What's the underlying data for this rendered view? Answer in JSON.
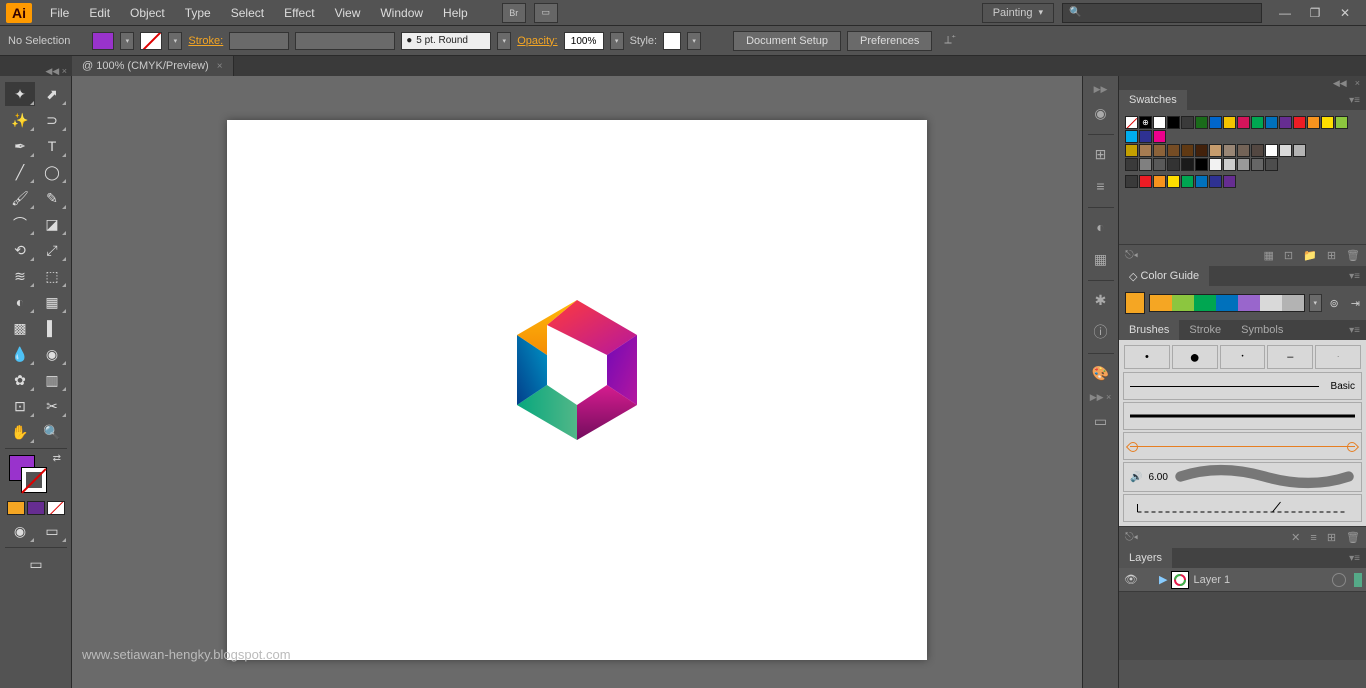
{
  "app": {
    "logo": "Ai"
  },
  "menu": [
    "File",
    "Edit",
    "Object",
    "Type",
    "Select",
    "Effect",
    "View",
    "Window",
    "Help"
  ],
  "workspace_label": "Painting",
  "controlbar": {
    "selection": "No Selection",
    "stroke_label": "Stroke:",
    "stroke_preset": "5 pt. Round",
    "opacity_label": "Opacity:",
    "opacity_value": "100%",
    "style_label": "Style:",
    "doc_setup": "Document Setup",
    "preferences": "Preferences"
  },
  "doctab": {
    "title": "@ 100% (CMYK/Preview)"
  },
  "watermark": "www.setiawan-hengky.blogspot.com",
  "panels": {
    "swatches": {
      "tab": "Swatches"
    },
    "colorguide": {
      "tab": "Color Guide"
    },
    "brushes": {
      "tabs": [
        "Brushes",
        "Stroke",
        "Symbols"
      ],
      "basic": "Basic",
      "cal": "6.00"
    },
    "layers": {
      "tab": "Layers",
      "layer1": "Layer 1"
    }
  },
  "swatch_colors_r1": [
    "#ffffff",
    "#000000",
    "#3a3a3a",
    "#1a6b1a",
    "#0066cc",
    "#f5c400",
    "#d4145a",
    "#00a651",
    "#0071bc",
    "#662d91",
    "#ed1c24",
    "#f7931e",
    "#ffde00",
    "#8cc63f",
    "#00aeef",
    "#2e3192",
    "#ec008c"
  ],
  "swatch_colors_r2": [
    "#c4a000",
    "#a67c52",
    "#8c6239",
    "#754c24",
    "#603913",
    "#42210b",
    "#c69c6d",
    "#998675",
    "#736357",
    "#534741",
    "#ffffff",
    "#d9d9d9",
    "#b3b3b3"
  ],
  "swatch_colors_r3": [
    "#808080",
    "#595959",
    "#333333",
    "#1a1a1a",
    "#000000",
    "#f2f2f2",
    "#cccccc",
    "#999999",
    "#666666",
    "#4d4d4d"
  ],
  "swatch_colors_r4": [
    "#ed1c24",
    "#f7931e",
    "#ffde00",
    "#00a651",
    "#0071bc",
    "#2e3192",
    "#662d91"
  ],
  "cg_colors": [
    "#f5a623",
    "#8cc63f",
    "#00a651",
    "#0071bc",
    "#9966cc",
    "#d9d9d9",
    "#b3b3b3"
  ]
}
